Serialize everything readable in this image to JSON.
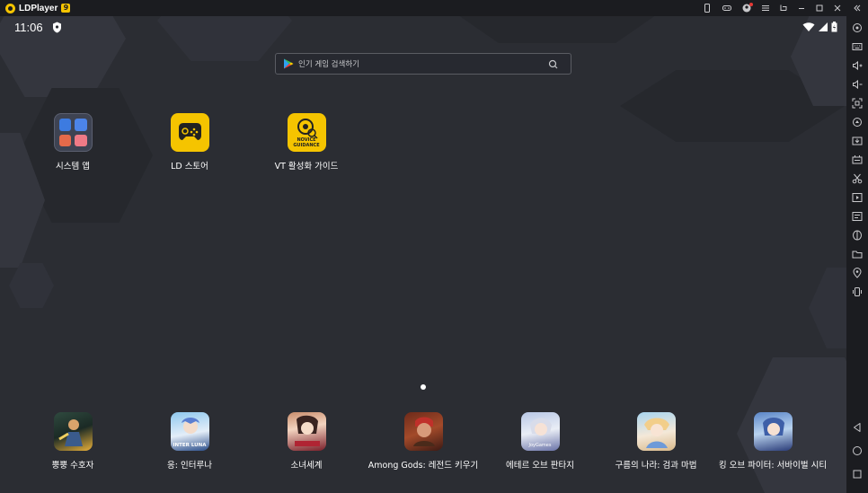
{
  "window": {
    "app_name": "LDPlayer",
    "badge": "9"
  },
  "status": {
    "time": "11:06"
  },
  "search": {
    "placeholder": "인기 게임 검색하기"
  },
  "desktop_apps": [
    {
      "label": "시스템 앱",
      "icon": "system-apps-folder-icon"
    },
    {
      "label": "LD 스토어",
      "icon": "ld-store-gamepad-icon",
      "color": "#f5c400"
    },
    {
      "label": "VT 활성화 가이드",
      "icon": "novice-guidance-icon",
      "color": "#f5c400",
      "icon_text": "NOVICE GUIDANCE"
    }
  ],
  "dock_apps": [
    {
      "label": "뿡뿡 수호자",
      "icon": "game-icon"
    },
    {
      "label": "응: 인터루나",
      "icon": "game-icon",
      "icon_text": "INTER LUNA"
    },
    {
      "label": "소녀세계",
      "icon": "game-icon"
    },
    {
      "label": "Among Gods: 레전드 키우기",
      "icon": "game-icon"
    },
    {
      "label": "에테르 오브 판타지",
      "icon": "game-icon",
      "icon_text": "JoyGames"
    },
    {
      "label": "구름의 나라: 검과 마법",
      "icon": "game-icon"
    },
    {
      "label": "킹 오브 파이터: 서바이벌 시티",
      "icon": "game-icon"
    }
  ],
  "title_controls": [
    "phone-icon",
    "gamepad-icon",
    "account-icon",
    "menu-icon",
    "restore-icon",
    "minimize-icon",
    "maximize-icon",
    "close-icon",
    "collapse-sidebar-icon"
  ],
  "sidebar_tools": [
    "settings-icon",
    "keyboard-icon",
    "volume-up-icon",
    "volume-down-icon",
    "screenshot-icon",
    "sync-icon",
    "apk-install-icon",
    "multi-instance-icon",
    "scissors-icon",
    "record-icon",
    "operation-icon",
    "rotate-icon",
    "folder-icon",
    "location-icon",
    "shake-icon",
    "back-icon",
    "home-icon",
    "recents-icon"
  ],
  "colors": {
    "accent": "#f5c400",
    "screen_bg": "#2b2d33",
    "chrome_bg": "#1b1c20"
  }
}
